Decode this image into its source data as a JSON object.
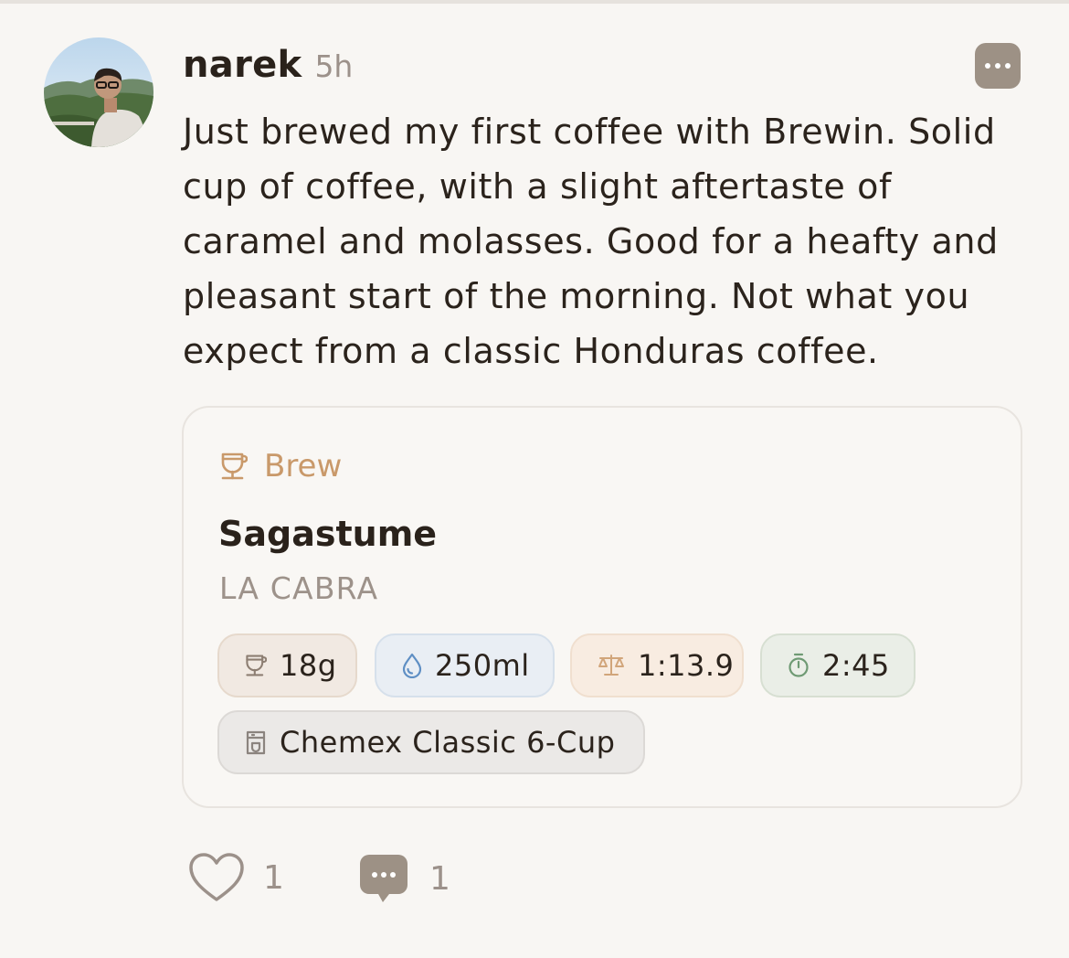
{
  "post": {
    "username": "narek",
    "time": "5h",
    "text": "Just brewed my first coffee with Brewin. Solid cup of coffee, with a slight aftertaste of caramel and molasses. Good for a heafty and pleasant start of the morning. Not what you expect from a classic Honduras coffee."
  },
  "brew_card": {
    "label": "Brew",
    "coffee_name": "Sagastume",
    "roaster": "LA CABRA",
    "dose": "18g",
    "water": "250ml",
    "ratio": "1:13.9",
    "time": "2:45",
    "gear": "Chemex Classic 6-Cup"
  },
  "actions": {
    "likes": "1",
    "comments": "1"
  },
  "colors": {
    "accent": "#c9996a",
    "background": "#f8f6f3",
    "text": "#2b231c",
    "muted": "#9c918a"
  }
}
